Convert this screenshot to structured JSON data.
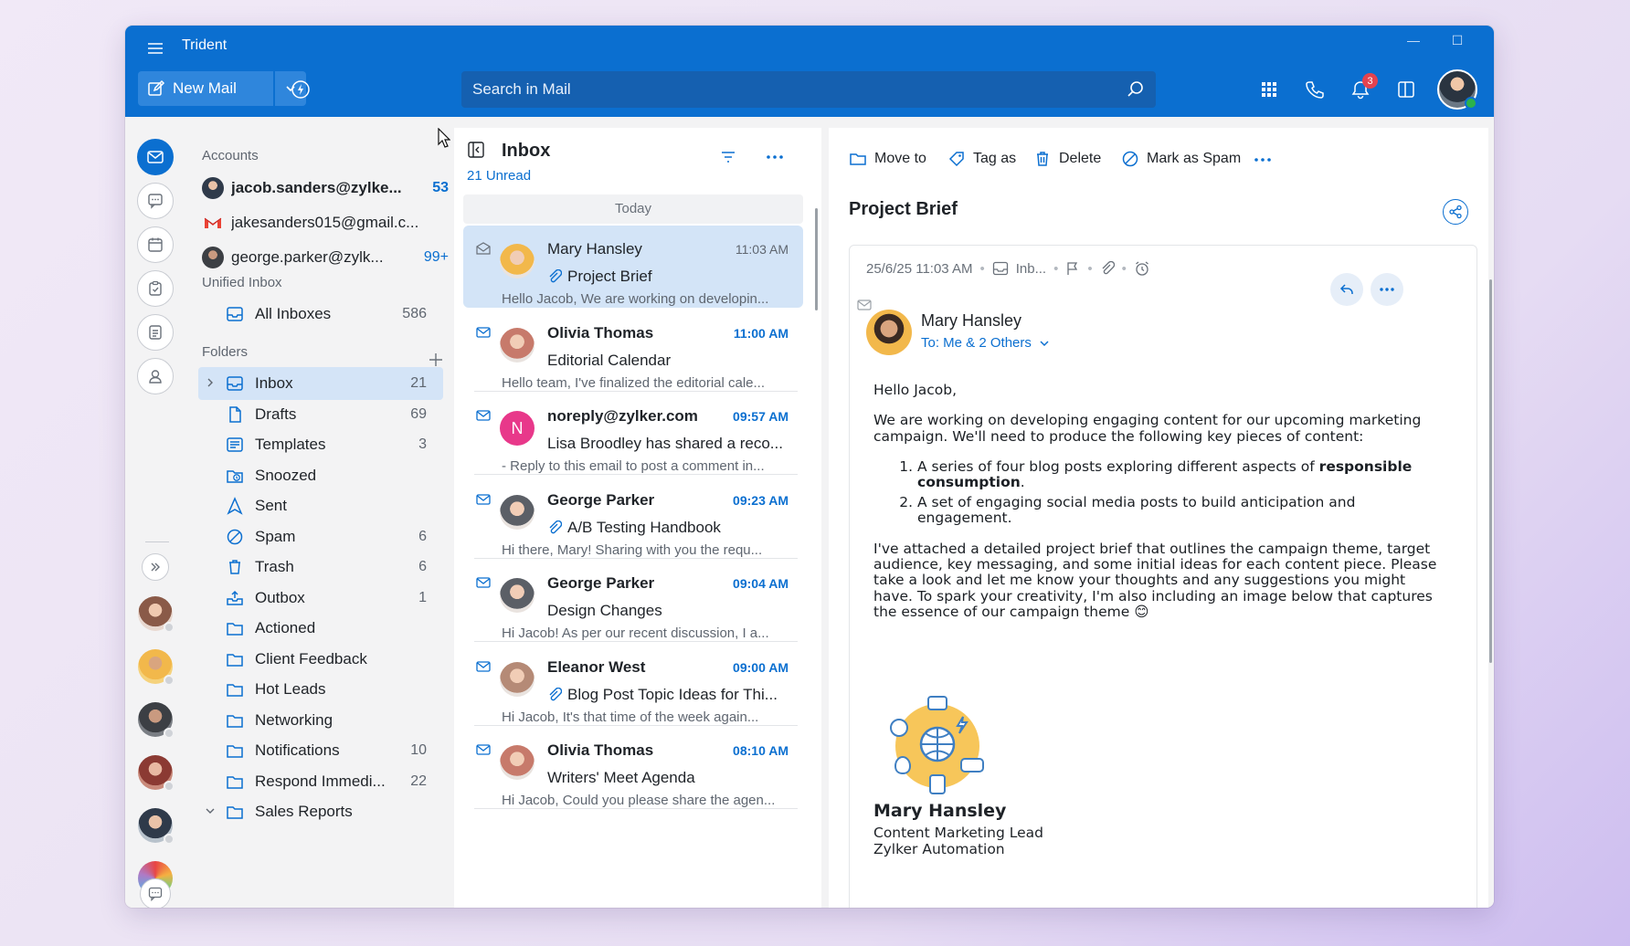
{
  "app": {
    "title": "Trident"
  },
  "toolbar": {
    "new_mail_label": "New Mail",
    "search_placeholder": "Search in Mail",
    "notification_count": "3"
  },
  "accounts": {
    "label": "Accounts",
    "items": [
      {
        "name": "jacob.sanders@zylke...",
        "count": "53"
      },
      {
        "name": "jakesanders015@gmail.c...",
        "count": ""
      },
      {
        "name": "george.parker@zylk...",
        "count": "99+"
      }
    ]
  },
  "unified": {
    "label": "Unified Inbox",
    "all_inboxes": {
      "name": "All Inboxes",
      "count": "586"
    }
  },
  "folders": {
    "label": "Folders",
    "items": [
      {
        "name": "Inbox",
        "count": "21",
        "icon": "inbox-icon"
      },
      {
        "name": "Drafts",
        "count": "69",
        "icon": "drafts-icon"
      },
      {
        "name": "Templates",
        "count": "3",
        "icon": "templates-icon"
      },
      {
        "name": "Snoozed",
        "count": "",
        "icon": "snoozed-icon"
      },
      {
        "name": "Sent",
        "count": "",
        "icon": "sent-icon"
      },
      {
        "name": "Spam",
        "count": "6",
        "icon": "spam-icon"
      },
      {
        "name": "Trash",
        "count": "6",
        "icon": "trash-icon"
      },
      {
        "name": "Outbox",
        "count": "1",
        "icon": "outbox-icon"
      },
      {
        "name": "Actioned",
        "count": "",
        "icon": "folder-icon"
      },
      {
        "name": "Client Feedback",
        "count": "",
        "icon": "folder-icon"
      },
      {
        "name": "Hot Leads",
        "count": "",
        "icon": "folder-icon"
      },
      {
        "name": "Networking",
        "count": "",
        "icon": "folder-icon"
      },
      {
        "name": "Notifications",
        "count": "10",
        "icon": "folder-icon"
      },
      {
        "name": "Respond Immedi...",
        "count": "22",
        "icon": "folder-icon"
      },
      {
        "name": "Sales Reports",
        "count": "",
        "icon": "folder-icon"
      }
    ]
  },
  "list": {
    "title": "Inbox",
    "unread": "21 Unread",
    "group": "Today",
    "mails": [
      {
        "from": "Mary Hansley",
        "time": "11:03 AM",
        "subject": "Project Brief",
        "preview": "Hello Jacob, We are working on developin...",
        "attachment": true,
        "avatar_color": "#f2b84b"
      },
      {
        "from": "Olivia Thomas",
        "time": "11:00 AM",
        "subject": "Editorial Calendar",
        "preview": "Hello team, I've finalized the editorial cale...",
        "attachment": false,
        "avatar_color": "#c77a6b"
      },
      {
        "from": "noreply@zylker.com",
        "time": "09:57 AM",
        "subject": "Lisa Broodley has shared a reco...",
        "preview": "- Reply to this email to post a comment in...",
        "attachment": false,
        "avatar_color": "#e8388a",
        "initial": "N"
      },
      {
        "from": "George Parker",
        "time": "09:23 AM",
        "subject": "A/B Testing Handbook",
        "preview": "Hi there, Mary! Sharing with you the requ...",
        "attachment": true,
        "avatar_color": "#5b5f66"
      },
      {
        "from": "George Parker",
        "time": "09:04 AM",
        "subject": "Design Changes",
        "preview": "Hi Jacob! As per our recent discussion, I a...",
        "attachment": false,
        "avatar_color": "#5b5f66"
      },
      {
        "from": "Eleanor West",
        "time": "09:00 AM",
        "subject": "Blog Post Topic Ideas for Thi...",
        "preview": "Hi Jacob, It's that time of the week again...",
        "attachment": true,
        "avatar_color": "#b58a76"
      },
      {
        "from": "Olivia Thomas",
        "time": "08:10 AM",
        "subject": "Writers' Meet Agenda",
        "preview": "Hi Jacob, Could you please share the agen...",
        "attachment": false,
        "avatar_color": "#c77a6b"
      }
    ]
  },
  "reader": {
    "actions": {
      "move": "Move to",
      "tag": "Tag as",
      "delete": "Delete",
      "spam": "Mark as Spam"
    },
    "subject": "Project Brief",
    "meta": {
      "date": "25/6/25 11:03 AM",
      "folder": "Inb..."
    },
    "sender": "Mary Hansley",
    "recipients": "To: Me & 2 Others",
    "body": {
      "greeting": "Hello Jacob,",
      "intro": "We are working on developing engaging content for our upcoming marketing campaign. We'll need to produce the following key pieces of content:",
      "item1_pre": "A series of four blog posts exploring different aspects of ",
      "item1_bold": "responsible consumption",
      "item1_post": ".",
      "item2": "A set of engaging social media posts to build anticipation and engagement.",
      "outro": "I've attached a detailed project brief that outlines the campaign theme, target audience, key messaging, and some initial ideas for each content piece. Please take a look and let me know your thoughts and any suggestions you might have. To spark your creativity, I'm also including an image below that captures the essence of our campaign theme 😊"
    },
    "signature": {
      "name": "Mary Hansley",
      "role": "Content Marketing Lead",
      "company": "Zylker Automation"
    }
  },
  "colors": {
    "accent": "#0b6fd0",
    "selected": "#d3e4f7",
    "badge": "#e3434f",
    "online": "#2bb24c"
  }
}
